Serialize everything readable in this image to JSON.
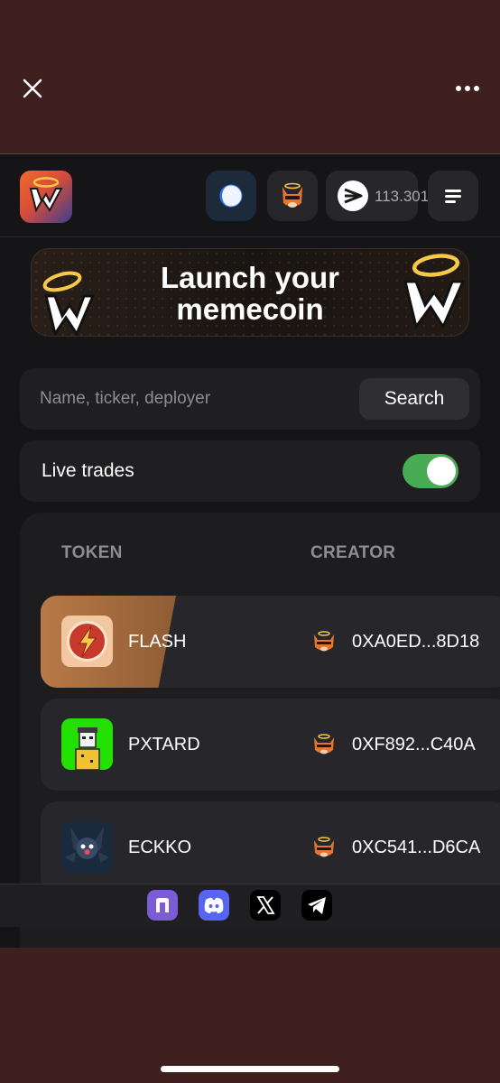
{
  "browser": {
    "close_icon": "close-icon",
    "more_icon": "more-icon"
  },
  "header": {
    "logo_icon": "wojak-logo-icon",
    "chain_icon": "chain-icon",
    "avatar_icon": "fox-avatar-icon",
    "balance": "113.301",
    "menu_icon": "menu-icon"
  },
  "banner": {
    "title_line1": "Launch your",
    "title_line2": "memecoin"
  },
  "search": {
    "placeholder": "Name, ticker, deployer",
    "value": "",
    "button_label": "Search"
  },
  "live_trades": {
    "label": "Live trades",
    "enabled": true
  },
  "table": {
    "columns": [
      "TOKEN",
      "CREATOR"
    ],
    "rows": [
      {
        "token": "FLASH",
        "creator": "0XA0ED...8D18",
        "icon": "flash-token-icon"
      },
      {
        "token": "PXTARD",
        "creator": "0XF892...C40A",
        "icon": "pxtard-token-icon"
      },
      {
        "token": "ECKKO",
        "creator": "0XC541...D6CA",
        "icon": "eckko-token-icon"
      }
    ]
  },
  "footer": {
    "socials": [
      "app-icon",
      "discord-icon",
      "x-icon",
      "telegram-icon"
    ]
  },
  "colors": {
    "background": "#151517",
    "chrome": "#3f201f",
    "accent_green": "#4aab55",
    "card": "#27272b"
  }
}
